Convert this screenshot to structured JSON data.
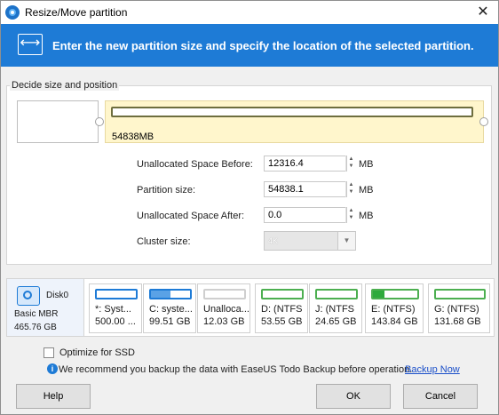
{
  "window": {
    "title": "Resize/Move partition",
    "close_glyph": "✕"
  },
  "banner": {
    "icon": "resize-arrows-icon",
    "icon_glyph": "⟷",
    "text": "Enter the new partition size and specify the location of the selected partition."
  },
  "group": {
    "legend": "Decide size and position"
  },
  "partition_map": {
    "size_label": "54838MB"
  },
  "form": {
    "unalloc_before_label": "Unallocated Space Before:",
    "unalloc_before_value": "12316.4",
    "partition_size_label": "Partition size:",
    "partition_size_value": "54838.1",
    "unalloc_after_label": "Unallocated Space After:",
    "unalloc_after_value": "0.0",
    "unit": "MB",
    "cluster_size_label": "Cluster size:",
    "cluster_size_value": "4K",
    "spin_up": "▲",
    "spin_down": "▼",
    "dropdown_glyph": "▼"
  },
  "disk": {
    "name": "Disk0",
    "type": "Basic MBR",
    "size": "465.76 GB",
    "partitions": [
      {
        "line1": "*: Syst...",
        "line2": "500.00 ...",
        "used_fraction": 0.0,
        "color": "#1e7bd6"
      },
      {
        "line1": "C: syste...",
        "line2": "99.51 GB",
        "used_fraction": 0.5,
        "color": "#1e7bd6"
      },
      {
        "line1": "Unalloca...",
        "line2": "12.03 GB",
        "used_fraction": 0.0,
        "color": "#cfcfcf"
      },
      {
        "line1": "D: (NTFS",
        "line2": "53.55 GB",
        "used_fraction": 0.0,
        "color": "#4caf50"
      },
      {
        "line1": "J: (NTFS",
        "line2": "24.65 GB",
        "used_fraction": 0.0,
        "color": "#4caf50"
      },
      {
        "line1": "E: (NTFS)",
        "line2": "143.84 GB",
        "used_fraction": 0.25,
        "color": "#4caf50"
      },
      {
        "line1": "G: (NTFS)",
        "line2": "131.68 GB",
        "used_fraction": 0.0,
        "color": "#4caf50"
      }
    ]
  },
  "options": {
    "optimize_ssd_label": "Optimize for SSD",
    "info_glyph": "i",
    "info_text": "We recommend you backup the data with EaseUS Todo Backup before operation.",
    "backup_link": "Backup Now"
  },
  "buttons": {
    "help": "Help",
    "ok": "OK",
    "cancel": "Cancel"
  }
}
